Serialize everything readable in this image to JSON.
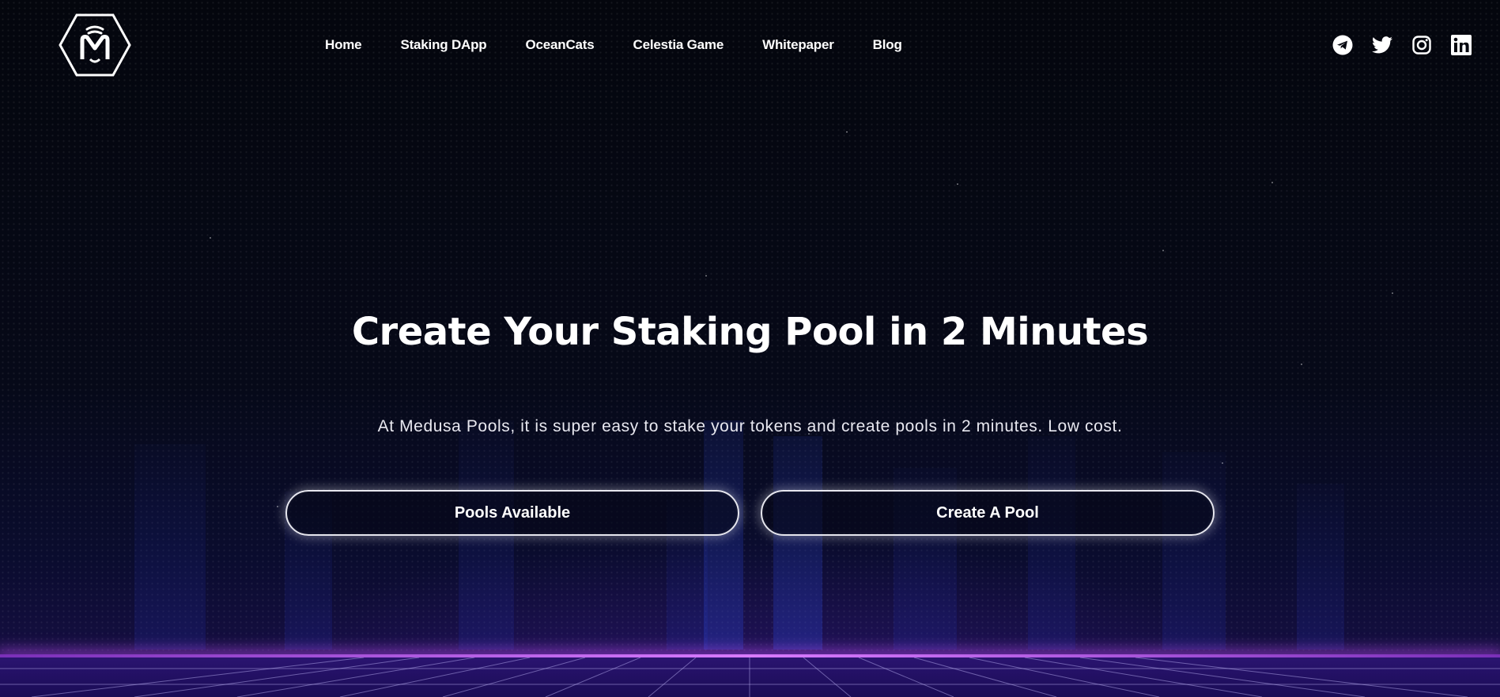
{
  "header": {
    "logo_icon": "medusa-hexagon-logo",
    "nav": [
      {
        "label": "Home"
      },
      {
        "label": "Staking DApp"
      },
      {
        "label": "OceanCats"
      },
      {
        "label": "Celestia Game"
      },
      {
        "label": "Whitepaper"
      },
      {
        "label": "Blog"
      }
    ],
    "socials": [
      {
        "icon": "telegram-icon"
      },
      {
        "icon": "twitter-icon"
      },
      {
        "icon": "instagram-icon"
      },
      {
        "icon": "linkedin-icon"
      }
    ]
  },
  "hero": {
    "title": "Create Your Staking Pool in 2 Minutes",
    "subtitle": "At Medusa Pools, it is super easy to stake your tokens and create pools in 2 minutes. Low cost.",
    "buttons": {
      "pools_available": "Pools Available",
      "create_pool": "Create A Pool"
    }
  },
  "colors": {
    "background": "#05070f",
    "accent_glow": "#d87bff",
    "floor": "#2a1470",
    "text": "#ffffff"
  }
}
